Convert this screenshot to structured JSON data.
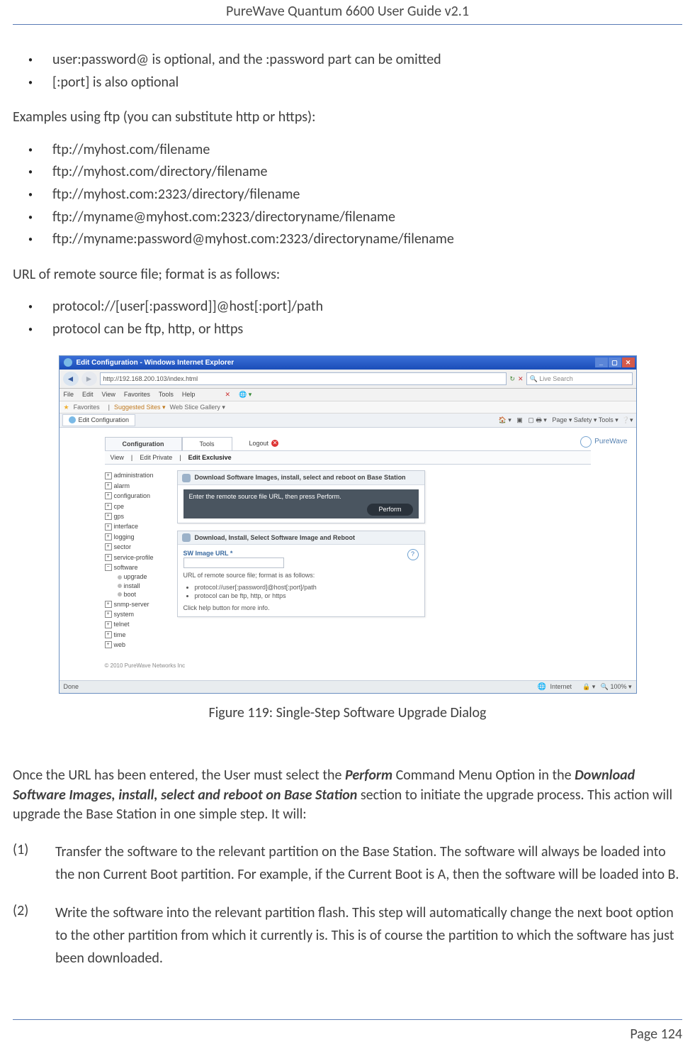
{
  "header": {
    "title": "PureWave Quantum 6600 User Guide v2.1"
  },
  "intro_bullets": [
    "user:password@ is optional, and the :password part can be omitted",
    "[:port] is also optional"
  ],
  "examples_intro": "Examples using ftp (you can substitute http or https):",
  "example_bullets": [
    "ftp://myhost.com/filename",
    "ftp://myhost.com/directory/filename",
    "ftp://myhost.com:2323/directory/filename",
    "ftp://myname@myhost.com:2323/directoryname/filename",
    "ftp://myname:password@myhost.com:2323/directoryname/filename"
  ],
  "format_intro": "URL of remote source file; format is as follows:",
  "format_bullets": [
    "protocol://[user[:password]]@host[:port]/path",
    "protocol can be ftp, http, or https"
  ],
  "screenshot": {
    "window_title": "Edit Configuration - Windows Internet Explorer",
    "address": "http://192.168.200.103/index.html",
    "search_placeholder": "Live Search",
    "menus": [
      "File",
      "Edit",
      "View",
      "Favorites",
      "Tools",
      "Help"
    ],
    "fav_label": "Favorites",
    "fav_links": [
      "Suggested Sites ▾",
      "Web Slice Gallery ▾"
    ],
    "tab_title": "Edit Configuration",
    "toolbar_text": "Page ▾   Safety ▾   Tools ▾",
    "tabs": {
      "config": "Configuration",
      "tools": "Tools",
      "logout": "Logout"
    },
    "brand": "PureWave",
    "subtabs": {
      "view": "View",
      "edit_private": "Edit Private",
      "edit_exclusive": "Edit Exclusive"
    },
    "tree": [
      "administration",
      "alarm",
      "configuration",
      "cpe",
      "gps",
      "interface",
      "logging",
      "sector",
      "service-profile",
      "software",
      "snmp-server",
      "system",
      "telnet",
      "time",
      "web"
    ],
    "tree_sw_children": [
      "upgrade",
      "install",
      "boot"
    ],
    "panel1": {
      "title": "Download Software Images, install, select and reboot on Base Station",
      "instr": "Enter the remote source file URL, then press Perform.",
      "btn": "Perform"
    },
    "panel2": {
      "title": "Download, Install, Select Software Image and Reboot",
      "label": "SW Image URL *",
      "hint_lead": "URL of remote source file; format is as follows:",
      "hint1": "protocol://user[:password]@host[:port]/path",
      "hint2": "protocol can be ftp, http, or https",
      "hint_more": "Click help button for more info."
    },
    "copyright": "© 2010 PureWave Networks Inc",
    "status": {
      "done": "Done",
      "zone": "Internet",
      "zoom": "100%"
    }
  },
  "figure_caption": "Figure 119: Single-Step Software Upgrade Dialog",
  "paragraph_after": {
    "pre": "Once the URL has been entered, the User must select the ",
    "btn": "Perform",
    "mid": " Command Menu Option in the ",
    "section": "Download Software Images, install, select and reboot on Base Station",
    "post": " section to initiate the upgrade process. This action will upgrade the Base Station in one simple step. It will:"
  },
  "steps": [
    {
      "num": "(1)",
      "text": "Transfer the software to the relevant partition on the Base Station. The software will always be loaded into the non Current Boot partition. For example, if the Current Boot is A, then the software will be loaded into B."
    },
    {
      "num": "(2)",
      "text": "Write the software into the relevant partition flash. This step will automatically change the next boot option to the other partition from which it currently is. This is of course the partition to which the software has just been downloaded."
    }
  ],
  "footer": {
    "page": "Page 124"
  }
}
